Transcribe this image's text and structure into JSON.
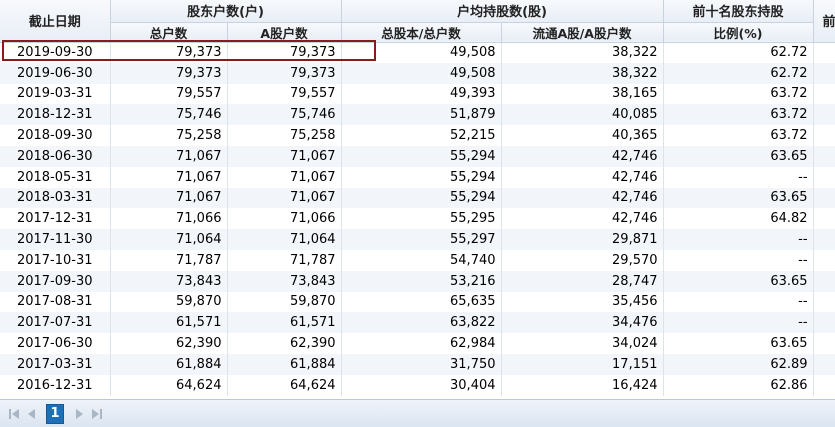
{
  "headers": {
    "date": "截止日期",
    "holders_group": "股东户数(户)",
    "holders_total": "总户数",
    "holders_a": "A股户数",
    "avg_group": "户均持股数(股)",
    "avg_total": "总股本/总户数",
    "avg_float": "流通A股/A股户数",
    "top10_line1": "前十名股东持股",
    "top10_line2": "比例(%)",
    "extra": "前"
  },
  "rows": [
    {
      "date": "2019-09-30",
      "total": "79,373",
      "a": "79,373",
      "avg_total": "49,508",
      "avg_float": "38,322",
      "top10": "62.72"
    },
    {
      "date": "2019-06-30",
      "total": "79,373",
      "a": "79,373",
      "avg_total": "49,508",
      "avg_float": "38,322",
      "top10": "62.72"
    },
    {
      "date": "2019-03-31",
      "total": "79,557",
      "a": "79,557",
      "avg_total": "49,393",
      "avg_float": "38,165",
      "top10": "63.72"
    },
    {
      "date": "2018-12-31",
      "total": "75,746",
      "a": "75,746",
      "avg_total": "51,879",
      "avg_float": "40,085",
      "top10": "63.72"
    },
    {
      "date": "2018-09-30",
      "total": "75,258",
      "a": "75,258",
      "avg_total": "52,215",
      "avg_float": "40,365",
      "top10": "63.72"
    },
    {
      "date": "2018-06-30",
      "total": "71,067",
      "a": "71,067",
      "avg_total": "55,294",
      "avg_float": "42,746",
      "top10": "63.65"
    },
    {
      "date": "2018-05-31",
      "total": "71,067",
      "a": "71,067",
      "avg_total": "55,294",
      "avg_float": "42,746",
      "top10": "--"
    },
    {
      "date": "2018-03-31",
      "total": "71,067",
      "a": "71,067",
      "avg_total": "55,294",
      "avg_float": "42,746",
      "top10": "63.65"
    },
    {
      "date": "2017-12-31",
      "total": "71,066",
      "a": "71,066",
      "avg_total": "55,295",
      "avg_float": "42,746",
      "top10": "64.82"
    },
    {
      "date": "2017-11-30",
      "total": "71,064",
      "a": "71,064",
      "avg_total": "55,297",
      "avg_float": "29,871",
      "top10": "--"
    },
    {
      "date": "2017-10-31",
      "total": "71,787",
      "a": "71,787",
      "avg_total": "54,740",
      "avg_float": "29,570",
      "top10": "--"
    },
    {
      "date": "2017-09-30",
      "total": "73,843",
      "a": "73,843",
      "avg_total": "53,216",
      "avg_float": "28,747",
      "top10": "63.65"
    },
    {
      "date": "2017-08-31",
      "total": "59,870",
      "a": "59,870",
      "avg_total": "65,635",
      "avg_float": "35,456",
      "top10": "--"
    },
    {
      "date": "2017-07-31",
      "total": "61,571",
      "a": "61,571",
      "avg_total": "63,822",
      "avg_float": "34,476",
      "top10": "--"
    },
    {
      "date": "2017-06-30",
      "total": "62,390",
      "a": "62,390",
      "avg_total": "62,984",
      "avg_float": "34,024",
      "top10": "63.65"
    },
    {
      "date": "2017-03-31",
      "total": "61,884",
      "a": "61,884",
      "avg_total": "31,750",
      "avg_float": "17,151",
      "top10": "62.89"
    },
    {
      "date": "2016-12-31",
      "total": "64,624",
      "a": "64,624",
      "avg_total": "30,404",
      "avg_float": "16,424",
      "top10": "62.86"
    }
  ],
  "pager": {
    "current_page": "1",
    "icons": [
      "first-page-icon",
      "prev-page-icon",
      "next-page-icon",
      "last-page-icon"
    ]
  },
  "colors": {
    "highlight_border": "#8b1a1a",
    "page_active": "#1d6fb8",
    "row_alt": "#f2f5fa"
  }
}
